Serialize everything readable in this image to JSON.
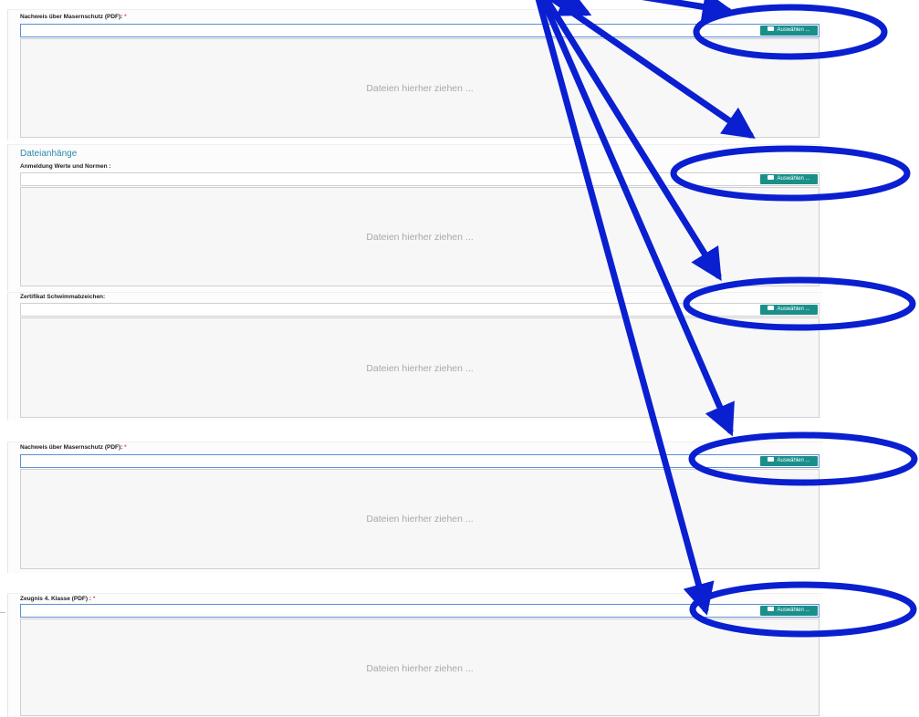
{
  "sections": [
    {
      "section_title": "",
      "label": "Nachweis über Masernschutz (PDF):",
      "required_marker": "*",
      "browse_label": "Auswählen ...",
      "drop_text": "Dateien hierher ziehen ..."
    },
    {
      "section_title": "Dateianhänge",
      "label": "Anmeldung Werte und Normen :",
      "required_marker": "",
      "browse_label": "Auswählen ...",
      "drop_text": "Dateien hierher ziehen ..."
    },
    {
      "section_title": "",
      "label": "Zertifikat Schwimmabzeichen:",
      "required_marker": "",
      "browse_label": "Auswählen ...",
      "drop_text": "Dateien hierher ziehen ..."
    },
    {
      "section_title": "",
      "label": "Nachweis über Masernschutz (PDF):",
      "required_marker": "*",
      "browse_label": "Auswählen ...",
      "drop_text": "Dateien hierher ziehen ..."
    },
    {
      "section_title": "",
      "label": "Zeugnis 4. Klasse (PDF) :",
      "required_marker": "*",
      "browse_label": "Auswählen ...",
      "drop_text": "Dateien hierher ziehen ..."
    }
  ],
  "icons": {
    "browse": "folder-open-icon"
  },
  "colors": {
    "button_bg": "#1a8f8a",
    "annotation": "#0a1fd0",
    "section_title": "#2a8aa8",
    "required": "#d9534f"
  }
}
